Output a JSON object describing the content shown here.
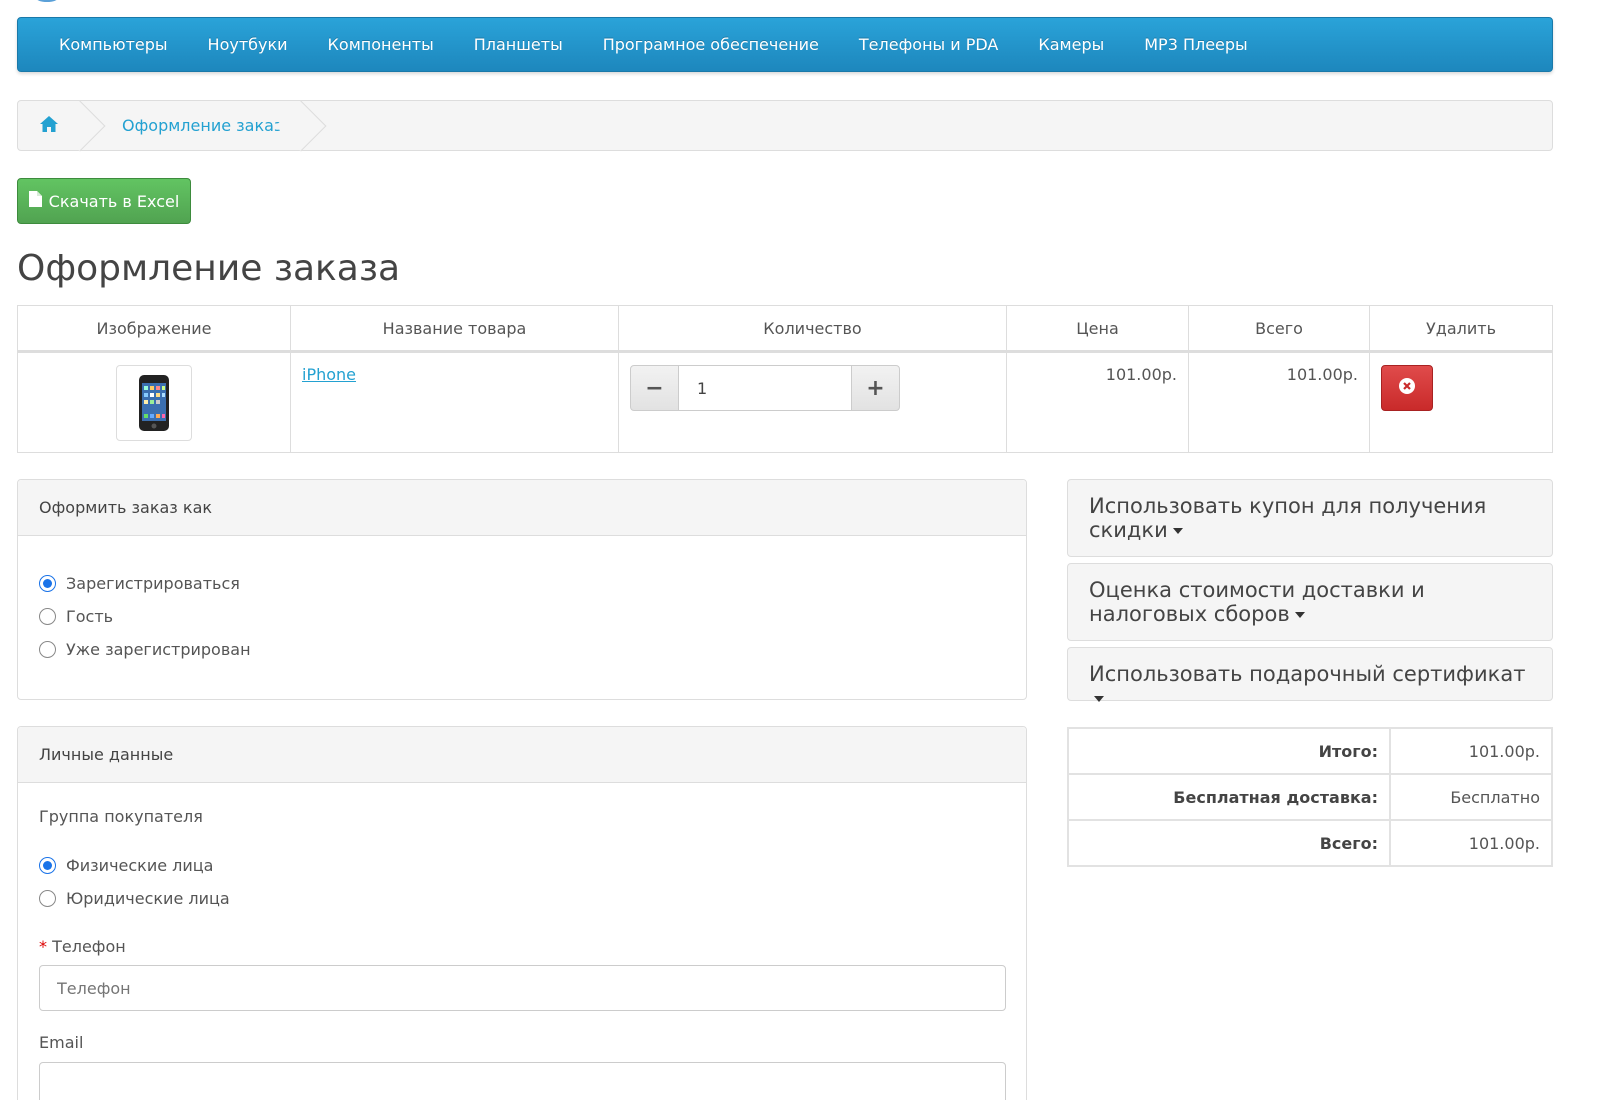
{
  "nav": {
    "items": [
      "Компьютеры",
      "Ноутбуки",
      "Компоненты",
      "Планшеты",
      "Програмное обеспечение",
      "Телефоны и PDA",
      "Камеры",
      "MP3 Плееры"
    ]
  },
  "breadcrumb": {
    "current": "Оформление заказа"
  },
  "toolbar": {
    "excel_label": "Скачать в Excel"
  },
  "page": {
    "title": "Оформление заказа"
  },
  "cart": {
    "headers": [
      "Изображение",
      "Название товара",
      "Количество",
      "Цена",
      "Всего",
      "Удалить"
    ],
    "rows": [
      {
        "name": "iPhone",
        "quantity": "1",
        "price": "101.00р.",
        "total": "101.00р."
      }
    ]
  },
  "checkout_as": {
    "title": "Оформить заказ как",
    "options": [
      "Зарегистрироваться",
      "Гость",
      "Уже зарегистрирован"
    ],
    "selected": "Зарегистрироваться"
  },
  "personal": {
    "title": "Личные данные",
    "group_label": "Группа покупателя",
    "groups": [
      "Физические лица",
      "Юридические лица"
    ],
    "selected_group": "Физические лица",
    "phone_label": "Телефон",
    "phone_placeholder": "Телефон",
    "email_label": "Email"
  },
  "accordions": {
    "coupon": "Использовать купон для получения скидки",
    "shipping": "Оценка стоимости доставки и налоговых сборов",
    "voucher": "Использовать подарочный сертификат"
  },
  "totals": [
    {
      "label": "Итого:",
      "value": "101.00р."
    },
    {
      "label": "Бесплатная доставка:",
      "value": "Бесплатно"
    },
    {
      "label": "Всего:",
      "value": "101.00р."
    }
  ],
  "colors": {
    "nav": "#229ac8",
    "link": "#23a1d1",
    "success": "#5bb75b",
    "danger": "#da4f49"
  }
}
